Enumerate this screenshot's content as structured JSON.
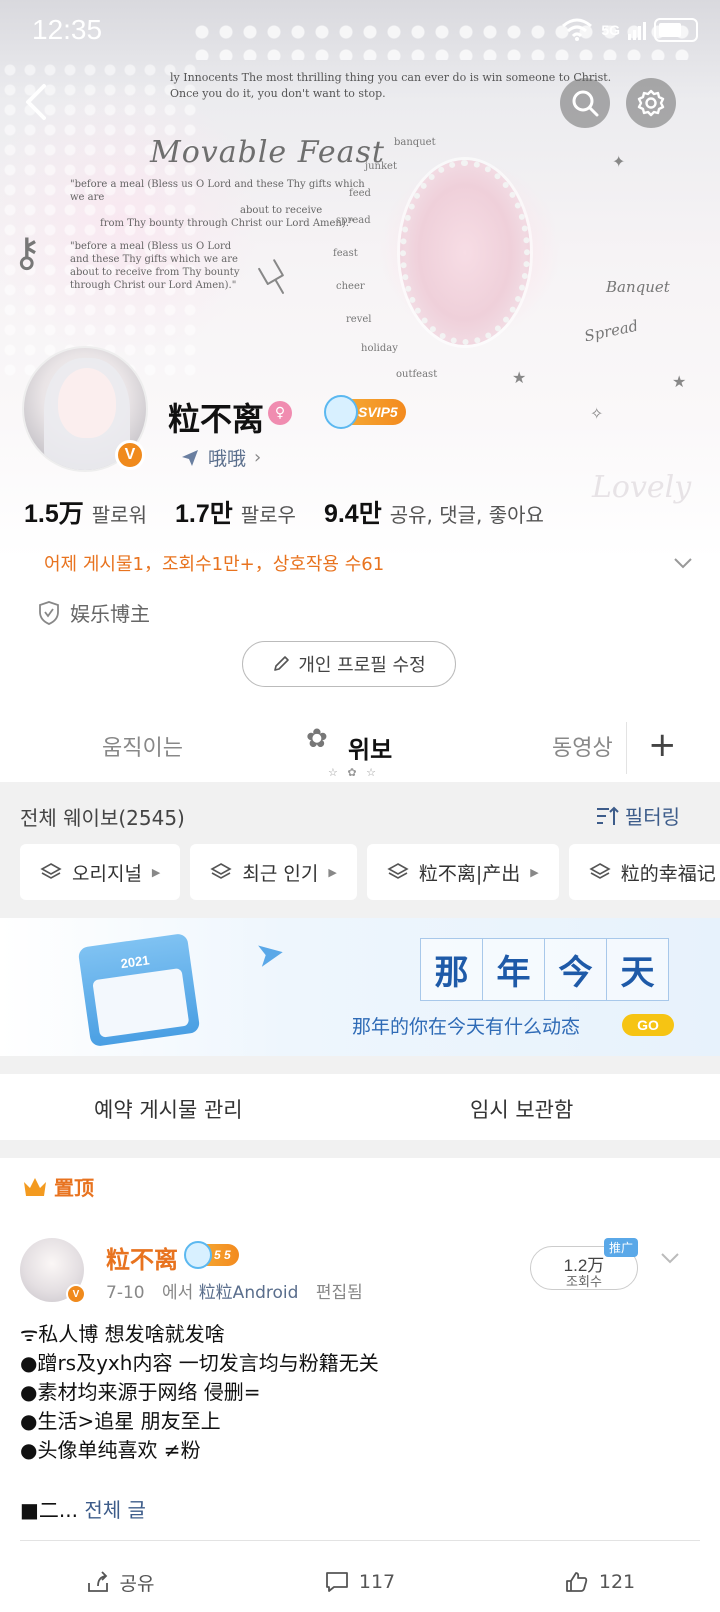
{
  "status_bar": {
    "time": "12:35",
    "network": "5G"
  },
  "banner": {
    "quote_line1": "ly Innocents The most thrilling thing you can ever do is win someone to Christ.",
    "quote_line2": "Once you do it, you don't want to stop.",
    "script_title": "Movable Feast",
    "poem_line1": "\"before a meal (Bless us O Lord and these Thy gifts which we are",
    "poem_line2": "about to receive",
    "poem_line3": "from Thy bounty through Christ our Lord Amen).\"",
    "poem_block": "\"before a meal (Bless us O Lord and these Thy gifts which we are about to receive from Thy bounty through Christ our Lord Amen).\"",
    "words": [
      "banquet",
      "junket",
      "feed",
      "spread",
      "feast",
      "cheer",
      "revel",
      "holiday",
      "outfeast"
    ],
    "script_right1": "Banquet",
    "script_right2": "Spread",
    "script_right3": "Lovely"
  },
  "profile": {
    "nickname": "粒不离",
    "svip_label": "SVIP5",
    "status_text": "哦哦",
    "stats": [
      {
        "value": "1.5万",
        "label": "팔로워"
      },
      {
        "value": "1.7만",
        "label": "팔로우"
      },
      {
        "value": "9.4만",
        "label": "공유, 댓글, 좋아요"
      }
    ],
    "activity": "어제 게시물1，조회수1만+，상호작용 수61",
    "tag": "娱乐博主",
    "edit_button": "개인 프로필 수정"
  },
  "tabs": {
    "items": [
      "움직이는",
      "위보",
      "동영상"
    ],
    "active": "위보",
    "plus": "+"
  },
  "filter": {
    "all_count": "전체 웨이보(2545)",
    "filter_label": "필터링",
    "chips": [
      "오리지널",
      "최근 인기",
      "粒不离|产出",
      "粒的幸福记"
    ]
  },
  "memory": {
    "year": "2021",
    "chars": [
      "那",
      "年",
      "今",
      "天"
    ],
    "subtitle": "那年的你在今天有什么动态",
    "go": "GO"
  },
  "manage": {
    "scheduled": "예약 게시물 관리",
    "drafts": "임시 보관함"
  },
  "post": {
    "pinned": "置顶",
    "author": "粒不离",
    "vip_label": "5 5",
    "date": "7-10",
    "via": "에서",
    "source": "粒粒Android",
    "edited": "편집됨",
    "views_value": "1.2万",
    "views_label": "조회수",
    "promo": "推广",
    "lines": [
      "ᯤ私人博 想发啥就发啥",
      "●蹭rs及yxh内容 一切发言均与粉籍无关",
      "●素材均来源于网络 侵删=",
      "●生活>追星  朋友至上",
      "●头像单纯喜欢  ≠粉"
    ],
    "truncated": "■二...",
    "full_text_link": "전체 글",
    "actions": [
      {
        "icon": "share-icon",
        "label": "공유"
      },
      {
        "icon": "comment-icon",
        "label": "117"
      },
      {
        "icon": "like-icon",
        "label": "121"
      }
    ]
  },
  "colors": {
    "accent_orange": "#e8731f",
    "link_blue": "#3d5c8a",
    "vip_gold": "#f38a1e"
  }
}
